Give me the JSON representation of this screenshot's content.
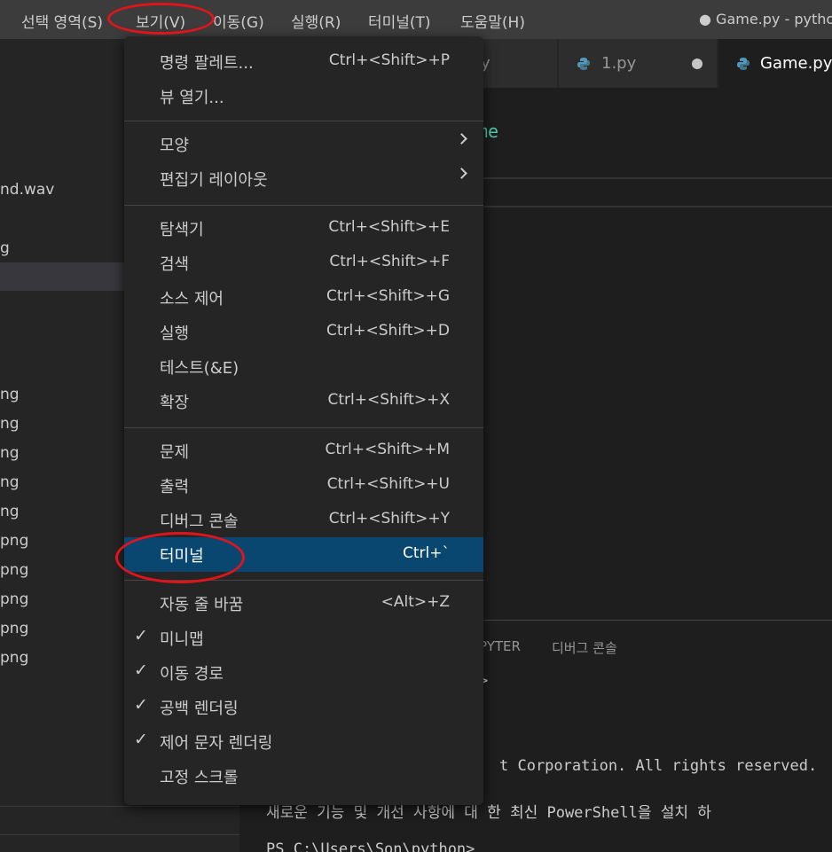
{
  "menubar": {
    "items": [
      "선택 영역(S)",
      "보기(V)",
      "이동(G)",
      "실행(R)",
      "터미널(T)",
      "도움말(H)"
    ],
    "window_title": "● Game.py - pytho"
  },
  "sidebar": {
    "rows": [
      "nd.wav",
      "g",
      "ng",
      "ng",
      "ng",
      "ng",
      "ng",
      "png",
      "png",
      "png",
      "png",
      "png"
    ]
  },
  "tabs": [
    {
      "label": "y",
      "icon": "python-icon"
    },
    {
      "label": "1.py",
      "icon": "python-icon",
      "modified": true
    },
    {
      "label": "Game.py",
      "icon": "python-icon",
      "active": true
    }
  ],
  "editor": {
    "breadcrumb_fragment": "me"
  },
  "panel": {
    "tabs": [
      "PYTER",
      "디버그 콘솔"
    ]
  },
  "terminal": {
    "lines": [
      ">",
      "t Corporation. All rights reserved.",
      "새로운 기능 및 개선 사항에 대 한 최신 PowerShell을 설치 하",
      "PS C:\\Users\\Son\\python>"
    ]
  },
  "view_menu": {
    "groups": [
      [
        {
          "label": "명령 팔레트...",
          "shortcut": "Ctrl+<Shift>+P"
        },
        {
          "label": "뷰 열기...",
          "shortcut": ""
        }
      ],
      [
        {
          "label": "모양",
          "submenu": true
        },
        {
          "label": "편집기 레이아웃",
          "submenu": true
        }
      ],
      [
        {
          "label": "탐색기",
          "shortcut": "Ctrl+<Shift>+E"
        },
        {
          "label": "검색",
          "shortcut": "Ctrl+<Shift>+F"
        },
        {
          "label": "소스 제어",
          "shortcut": "Ctrl+<Shift>+G"
        },
        {
          "label": "실행",
          "shortcut": "Ctrl+<Shift>+D"
        },
        {
          "label": "테스트(&E)",
          "shortcut": ""
        },
        {
          "label": "확장",
          "shortcut": "Ctrl+<Shift>+X"
        }
      ],
      [
        {
          "label": "문제",
          "shortcut": "Ctrl+<Shift>+M"
        },
        {
          "label": "출력",
          "shortcut": "Ctrl+<Shift>+U"
        },
        {
          "label": "디버그 콘솔",
          "shortcut": "Ctrl+<Shift>+Y"
        },
        {
          "label": "터미널",
          "shortcut": "Ctrl+`",
          "highlighted": true
        }
      ],
      [
        {
          "label": "자동 줄 바꿈",
          "shortcut": "<Alt>+Z"
        },
        {
          "label": "미니맵",
          "checked": true
        },
        {
          "label": "이동 경로",
          "checked": true
        },
        {
          "label": "공백 렌더링",
          "checked": true
        },
        {
          "label": "제어 문자 렌더링",
          "checked": true
        },
        {
          "label": "고정 스크롤"
        }
      ]
    ]
  },
  "colors": {
    "highlight": "#094771",
    "annotation_ring": "#e0141b",
    "accent_teal": "#4ec9b0"
  }
}
